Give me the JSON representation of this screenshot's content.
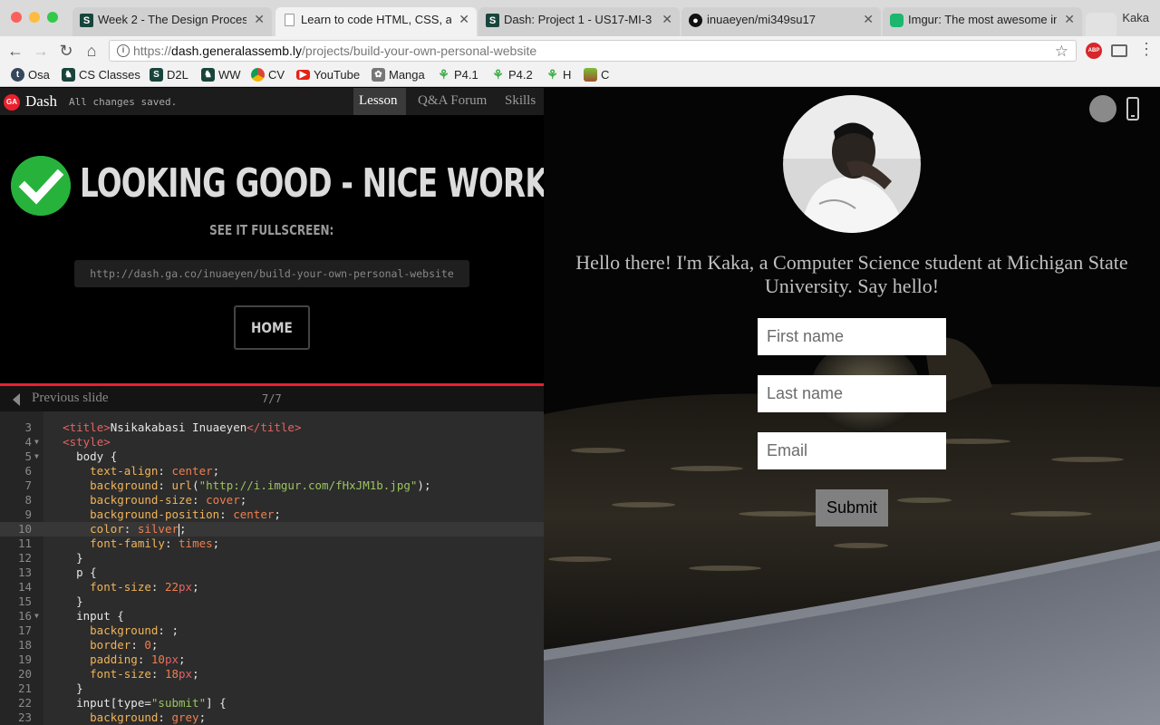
{
  "browser": {
    "tabs": [
      {
        "label": "Week 2 - The Design Process",
        "icon": "msu-spartan-icon",
        "active": false
      },
      {
        "label": "Learn to code HTML, CSS, an",
        "icon": "page-icon",
        "active": true
      },
      {
        "label": "Dash: Project 1 - US17-MI-3",
        "icon": "msu-spartan-icon",
        "active": false
      },
      {
        "label": "inuaeyen/mi349su17",
        "icon": "github-icon",
        "active": false
      },
      {
        "label": "Imgur: The most awesome im",
        "icon": "imgur-icon",
        "active": false
      }
    ],
    "profile_name": "Kaka",
    "url_scheme": "https://",
    "url_host": "dash.generalassemb.ly",
    "url_path": "/projects/build-your-own-personal-website",
    "bookmarks": [
      {
        "label": "Osa",
        "icon": "tumblr-icon"
      },
      {
        "label": "CS Classes",
        "icon": "spartan-helmet-icon"
      },
      {
        "label": "D2L",
        "icon": "msu-s-icon"
      },
      {
        "label": "WW",
        "icon": "spartan-helmet-icon"
      },
      {
        "label": "CV",
        "icon": "chrome-icon"
      },
      {
        "label": "YouTube",
        "icon": "youtube-icon"
      },
      {
        "label": "Manga",
        "icon": "manga-icon"
      },
      {
        "label": "P4.1",
        "icon": "plant-icon"
      },
      {
        "label": "P4.2",
        "icon": "plant-icon"
      },
      {
        "label": "H",
        "icon": "plant-icon"
      },
      {
        "label": "C",
        "icon": "app-icon"
      }
    ]
  },
  "dash": {
    "brand": "Dash",
    "save_status": "All changes saved.",
    "tabs": [
      {
        "label": "Lesson",
        "active": true
      },
      {
        "label": "Q&A Forum",
        "active": false
      },
      {
        "label": "Skills",
        "active": false
      }
    ],
    "headline": "LOOKING GOOD - NICE WORK!",
    "fullscreen_label": "SEE IT FULLSCREEN:",
    "share_url": "http://dash.ga.co/inuaeyen/build-your-own-personal-website",
    "home_label": "HOME",
    "prev_slide_label": "Previous slide",
    "slide_counter": "7/7",
    "accent_color": "#e9212e",
    "success_color": "#27b23c"
  },
  "editor": {
    "current_line": 10,
    "lines": [
      {
        "n": 3,
        "text": "  <title>Nsikakabasi Inuaeyen</title>"
      },
      {
        "n": 4,
        "text": "  <style>",
        "fold": true
      },
      {
        "n": 5,
        "text": "    body {",
        "fold": true
      },
      {
        "n": 6,
        "text": "      text-align: center;"
      },
      {
        "n": 7,
        "text": "      background: url(\"http://i.imgur.com/fHxJM1b.jpg\");"
      },
      {
        "n": 8,
        "text": "      background-size: cover;"
      },
      {
        "n": 9,
        "text": "      background-position: center;"
      },
      {
        "n": 10,
        "text": "      color: silver;"
      },
      {
        "n": 11,
        "text": "      font-family: times;"
      },
      {
        "n": 12,
        "text": "    }"
      },
      {
        "n": 13,
        "text": "    p {"
      },
      {
        "n": 14,
        "text": "      font-size: 22px;"
      },
      {
        "n": 15,
        "text": "    }"
      },
      {
        "n": 16,
        "text": "    input {",
        "fold": true
      },
      {
        "n": 17,
        "text": "      background: ;"
      },
      {
        "n": 18,
        "text": "      border: 0;"
      },
      {
        "n": 19,
        "text": "      padding: 10px;"
      },
      {
        "n": 20,
        "text": "      font-size: 18px;"
      },
      {
        "n": 21,
        "text": "    }"
      },
      {
        "n": 22,
        "text": "    input[type=\"submit\"] {"
      },
      {
        "n": 23,
        "text": "      background: grey;"
      }
    ]
  },
  "preview": {
    "intro": "Hello there! I'm Kaka, a Computer Science student at Michigan State University. Say hello!",
    "first_name_placeholder": "First name",
    "last_name_placeholder": "Last name",
    "email_placeholder": "Email",
    "submit_label": "Submit"
  }
}
